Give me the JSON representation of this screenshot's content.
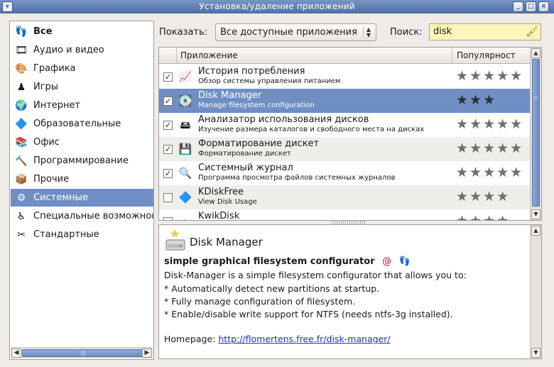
{
  "window": {
    "title": "Установка/удаление приложений",
    "menu_icon": "window-menu-icon"
  },
  "sidebar": {
    "items": [
      {
        "label": "Все",
        "icon": "all-apps-icon"
      },
      {
        "label": "Аудио и видео",
        "icon": "audio-video-icon"
      },
      {
        "label": "Графика",
        "icon": "graphics-icon"
      },
      {
        "label": "Игры",
        "icon": "games-icon"
      },
      {
        "label": "Интернет",
        "icon": "internet-icon"
      },
      {
        "label": "Образовательные",
        "icon": "education-icon"
      },
      {
        "label": "Офис",
        "icon": "office-icon"
      },
      {
        "label": "Программирование",
        "icon": "programming-icon"
      },
      {
        "label": "Прочие",
        "icon": "other-icon"
      },
      {
        "label": "Системные",
        "icon": "system-icon",
        "selected": true
      },
      {
        "label": "Специальные возможности",
        "icon": "accessibility-icon"
      },
      {
        "label": "Стандартные",
        "icon": "accessories-icon"
      }
    ]
  },
  "filter": {
    "show_label": "Показать:",
    "show_value": "Все доступные приложения",
    "search_label": "Поиск:",
    "search_value": "disk"
  },
  "list": {
    "columns": {
      "app": "Приложение",
      "popularity": "Популярност"
    },
    "rows": [
      {
        "name": "История потребления",
        "desc": "Обзор системы управления питанием",
        "checked": true,
        "stars": 5,
        "icon": "chart-icon"
      },
      {
        "name": "Disk Manager",
        "desc": "Manage filesystem configuration",
        "checked": true,
        "stars": 3,
        "icon": "disk-manager-icon",
        "selected": true
      },
      {
        "name": "Анализатор использования дисков",
        "desc": "Изучение размера каталогов и свободного места на дисках",
        "checked": true,
        "stars": 5,
        "icon": "disk-usage-icon"
      },
      {
        "name": "Форматирование дискет",
        "desc": "Форматирование дискет",
        "checked": true,
        "stars": 5,
        "icon": "floppy-icon"
      },
      {
        "name": "Системный журнал",
        "desc": "Программа просмотра файлов системных журналов",
        "checked": true,
        "stars": 5,
        "icon": "log-viewer-icon"
      },
      {
        "name": "KDiskFree",
        "desc": "View Disk Usage",
        "checked": false,
        "stars": 4,
        "icon": "kdiskfree-icon"
      },
      {
        "name": "KwikDisk",
        "desc": "",
        "checked": false,
        "stars": 4,
        "icon": "kwikdisk-icon"
      }
    ]
  },
  "detail": {
    "title": "Disk Manager",
    "summary": "simple graphical filesystem configurator",
    "lines": [
      "Disk-Manager is a simple filesystem configurator that allows you to:",
      "* Automatically detect new partitions at startup.",
      "* Fully manage configuration of filesystem.",
      "* Enable/disable write support for NTFS (needs ntfs-3g installed)."
    ],
    "homepage_label": "Homepage:",
    "homepage_url": "http://flomertens.free.fr/disk-manager/"
  },
  "colors": {
    "selection": "#6f8fc4",
    "titlebar": "#5b7cb3",
    "search_bg": "#fbf6ba"
  }
}
